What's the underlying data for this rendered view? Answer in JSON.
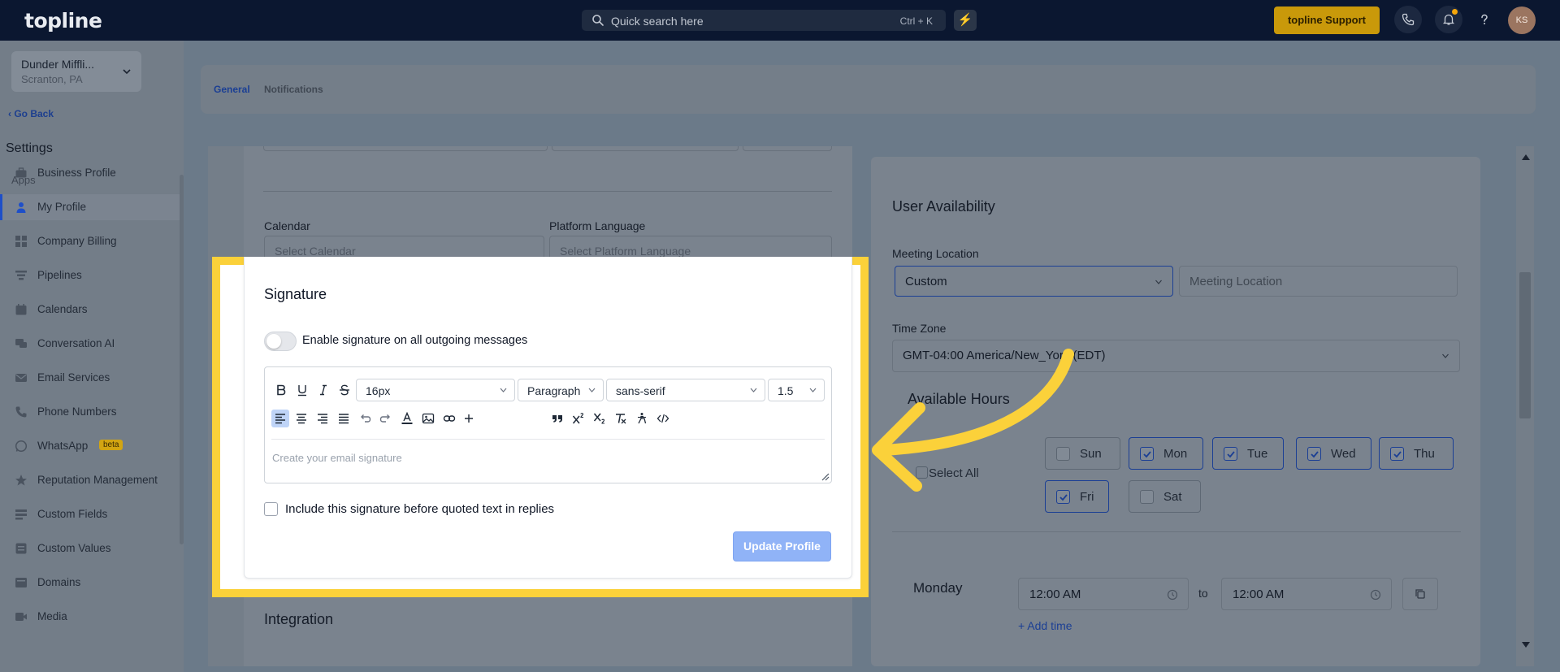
{
  "topbar": {
    "logo": "topline",
    "search_placeholder": "Quick search here",
    "search_shortcut": "Ctrl + K",
    "support_label": "topline Support",
    "avatar_initials": "KS"
  },
  "sidebar": {
    "location_name": "Dunder Miffli...",
    "location_sub": "Scranton, PA",
    "go_back": "Go Back",
    "title": "Settings",
    "section_label": "Apps",
    "items": [
      {
        "label": "Business Profile",
        "icon": "briefcase-icon"
      },
      {
        "label": "My Profile",
        "icon": "user-icon"
      },
      {
        "label": "Company Billing",
        "icon": "grid-icon"
      },
      {
        "label": "Pipelines",
        "icon": "filter-icon"
      },
      {
        "label": "Calendars",
        "icon": "calendar-icon"
      },
      {
        "label": "Conversation AI",
        "icon": "chat-icon"
      },
      {
        "label": "Email Services",
        "icon": "mail-icon"
      },
      {
        "label": "Phone Numbers",
        "icon": "phone-icon"
      },
      {
        "label": "WhatsApp",
        "icon": "whatsapp-icon",
        "badge": "beta"
      },
      {
        "label": "Reputation Management",
        "icon": "star-icon"
      },
      {
        "label": "Custom Fields",
        "icon": "fields-icon"
      },
      {
        "label": "Custom Values",
        "icon": "values-icon"
      },
      {
        "label": "Domains",
        "icon": "globe-icon"
      },
      {
        "label": "Media",
        "icon": "media-icon"
      }
    ]
  },
  "tabs": {
    "general": "General",
    "notifications": "Notifications"
  },
  "profile_form": {
    "calendar_label": "Calendar",
    "calendar_placeholder": "Select Calendar",
    "language_label": "Platform Language",
    "language_placeholder": "Select Platform Language",
    "integration_title": "Integration"
  },
  "signature": {
    "title": "Signature",
    "toggle_label": "Enable signature on all outgoing messages",
    "font_size": "16px",
    "block_format": "Paragraph",
    "font_family": "sans-serif",
    "line_height": "1.5",
    "editor_placeholder": "Create your email signature",
    "include_label": "Include this signature before quoted text in replies",
    "update_button": "Update Profile"
  },
  "availability": {
    "title": "User Availability",
    "meeting_location_label": "Meeting Location",
    "meeting_location_value": "Custom",
    "meeting_location_placeholder": "Meeting Location",
    "timezone_label": "Time Zone",
    "timezone_value": "GMT-04:00 America/New_York (EDT)",
    "available_hours_title": "Available Hours",
    "select_all": "Select All",
    "days": [
      {
        "label": "Sun",
        "checked": false
      },
      {
        "label": "Mon",
        "checked": true
      },
      {
        "label": "Tue",
        "checked": true
      },
      {
        "label": "Wed",
        "checked": true
      },
      {
        "label": "Thu",
        "checked": true
      },
      {
        "label": "Fri",
        "checked": true
      },
      {
        "label": "Sat",
        "checked": false
      }
    ],
    "monday_label": "Monday",
    "start_time": "12:00 AM",
    "to_label": "to",
    "end_time": "12:00 AM",
    "add_time": "+ Add time"
  },
  "colors": {
    "accent": "#1b3f94",
    "highlight": "#fbd13a",
    "support_button": "#c9990a",
    "update_button": "#90b3f7"
  }
}
